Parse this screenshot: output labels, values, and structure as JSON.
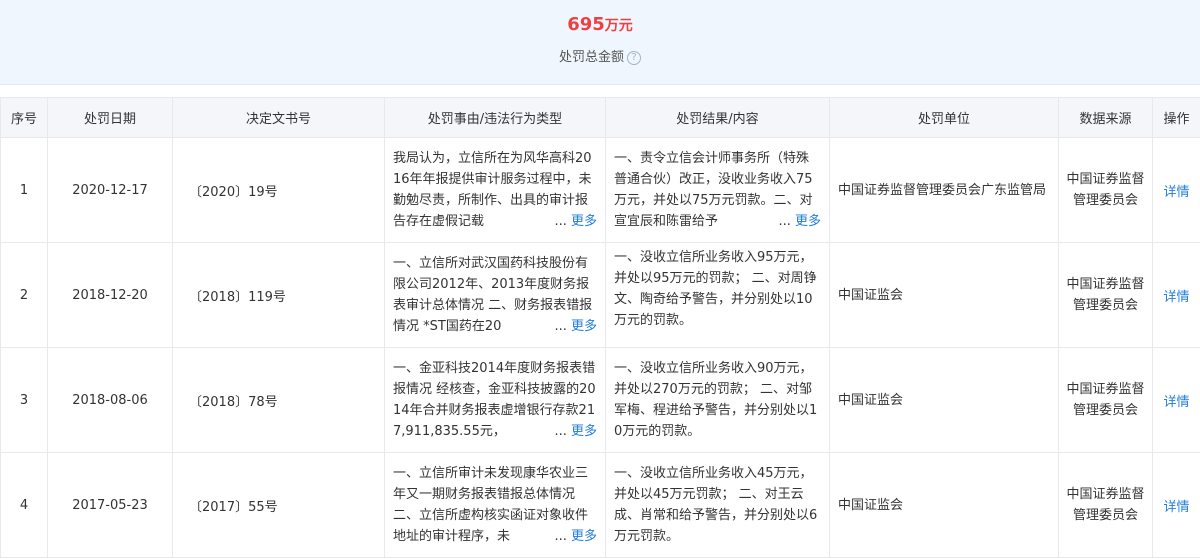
{
  "summary": {
    "amount_number": "695",
    "amount_unit": "万元",
    "caption": "处罚总金额",
    "help_glyph": "?"
  },
  "table": {
    "headers": [
      "序号",
      "处罚日期",
      "决定文书号",
      "处罚事由/违法行为类型",
      "处罚结果/内容",
      "处罚单位",
      "数据来源",
      "操作"
    ],
    "more_ellipsis": "...",
    "more_label": "更多",
    "rows": [
      {
        "index": "1",
        "date": "2020-12-17",
        "doc_no": "〔2020〕19号",
        "reason": "我局认为，立信所在为风华高科2016年年报提供审计服务过程中，未勤勉尽责，所制作、出具的审计报告存在虚假记载",
        "result": "一、责令立信会计师事务所（特殊普通合伙）改正，没收业务收入75万元，并处以75万元罚款。二、对宣宜辰和陈雷给予",
        "unit": "中国证券监督管理委员会广东监管局",
        "source": "中国证券监督管理委员会",
        "action": "详情"
      },
      {
        "index": "2",
        "date": "2018-12-20",
        "doc_no": "〔2018〕119号",
        "reason": "一、立信所对武汉国药科技股份有限公司2012年、2013年度财务报表审计总体情况 二、财务报表错报情况 *ST国药在20",
        "result": "一、没收立信所业务收入95万元，并处以95万元的罚款； 二、对周铮文、陶奇给予警告，并分别处以10万元的罚款。",
        "unit": "中国证监会",
        "source": "中国证券监督管理委员会",
        "action": "详情"
      },
      {
        "index": "3",
        "date": "2018-08-06",
        "doc_no": "〔2018〕78号",
        "reason": "一、金亚科技2014年度财务报表错报情况 经核查，金亚科技披露的2014年合并财务报表虚增银行存款217,911,835.55元，",
        "result": "一、没收立信所业务收入90万元，并处以270万元的罚款； 二、对邹军梅、程进给予警告，并分别处以10万元的罚款。",
        "unit": "中国证监会",
        "source": "中国证券监督管理委员会",
        "action": "详情"
      },
      {
        "index": "4",
        "date": "2017-05-23",
        "doc_no": "〔2017〕55号",
        "reason": "一、立信所审计未发现康华农业三年又一期财务报表错报总体情况 二、立信所虚构核实函证对象收件地址的审计程序，未",
        "result": "一、没收立信所业务收入45万元，并处以45万元罚款； 二、对王云成、肖常和给予警告，并分别处以6万元罚款。",
        "unit": "中国证监会",
        "source": "中国证券监督管理委员会",
        "action": "详情"
      }
    ]
  },
  "colors": {
    "amount": "#ee4040",
    "link": "#1f7ddc",
    "summary_bg": "#f0f6fd",
    "header_bg": "#f4f6fa"
  }
}
